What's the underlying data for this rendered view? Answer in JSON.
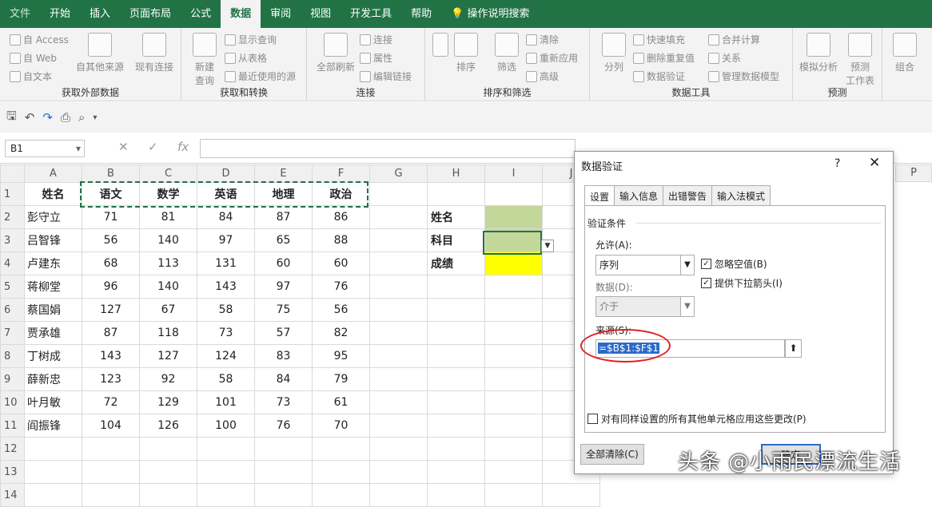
{
  "tabs": [
    "文件",
    "开始",
    "插入",
    "页面布局",
    "公式",
    "数据",
    "审阅",
    "视图",
    "开发工具",
    "帮助"
  ],
  "tell_me": "操作说明搜索",
  "ribbon": {
    "get_external": {
      "label": "获取外部数据",
      "access": "自 Access",
      "web": "自 Web",
      "text": "自文本",
      "other": "自其他来源",
      "existing": "现有连接"
    },
    "transform": {
      "label": "获取和转换",
      "new_query": "新建\n查询",
      "show_queries": "显示查询",
      "from_table": "从表格",
      "recent": "最近使用的源"
    },
    "connections": {
      "label": "连接",
      "refresh_all": "全部刷新",
      "connections": "连接",
      "properties": "属性",
      "edit_links": "编辑链接"
    },
    "sort_filter": {
      "label": "排序和筛选",
      "sort": "排序",
      "filter": "筛选",
      "clear": "清除",
      "reapply": "重新应用",
      "advanced": "高级"
    },
    "data_tools": {
      "label": "数据工具",
      "split": "分列",
      "flash_fill": "快速填充",
      "remove_dup": "删除重复值",
      "validation": "数据验证",
      "consolidate": "合并计算",
      "relations": "关系",
      "manage_model": "管理数据模型"
    },
    "forecast": {
      "label": "预测",
      "what_if": "模拟分析",
      "forecast_sheet": "预测\n工作表"
    },
    "outline": {
      "group": "组合"
    }
  },
  "namebox": "B1",
  "columns": [
    "A",
    "B",
    "C",
    "D",
    "E",
    "F",
    "G",
    "H",
    "I",
    "J"
  ],
  "headers": [
    "姓名",
    "语文",
    "数学",
    "英语",
    "地理",
    "政治"
  ],
  "rows": [
    [
      "彭守立",
      "71",
      "81",
      "84",
      "87",
      "86"
    ],
    [
      "吕智锋",
      "56",
      "140",
      "97",
      "65",
      "88"
    ],
    [
      "卢建东",
      "68",
      "113",
      "131",
      "60",
      "60"
    ],
    [
      "蒋柳堂",
      "96",
      "140",
      "143",
      "97",
      "76"
    ],
    [
      "蔡国娟",
      "127",
      "67",
      "58",
      "75",
      "56"
    ],
    [
      "贾承雄",
      "87",
      "118",
      "73",
      "57",
      "82"
    ],
    [
      "丁树成",
      "143",
      "127",
      "124",
      "83",
      "95"
    ],
    [
      "薛新忠",
      "123",
      "92",
      "58",
      "84",
      "79"
    ],
    [
      "叶月敏",
      "72",
      "129",
      "101",
      "73",
      "61"
    ],
    [
      "阎振锋",
      "104",
      "126",
      "100",
      "76",
      "70"
    ]
  ],
  "side_labels": [
    "姓名",
    "科目",
    "成绩"
  ],
  "row_numbers": [
    "1",
    "2",
    "3",
    "4",
    "5",
    "6",
    "7",
    "8",
    "9",
    "10",
    "11",
    "12",
    "13",
    "14"
  ],
  "dialog": {
    "title": "数据验证",
    "help": "?",
    "close": "✕",
    "tabs": [
      "设置",
      "输入信息",
      "出错警告",
      "输入法模式"
    ],
    "section": "验证条件",
    "allow_label": "允许(A):",
    "allow_value": "序列",
    "data_label": "数据(D):",
    "data_value": "介于",
    "ignore_blank": "忽略空值(B)",
    "dropdown": "提供下拉箭头(I)",
    "source_label": "来源(S):",
    "source_value": "=$B$1:$F$1",
    "apply_all": "对有同样设置的所有其他单元格应用这些更改(P)",
    "clear_all": "全部清除(C)",
    "ok": "确定"
  },
  "column_p": "P",
  "watermark": "头条 @小雨民漂流生活"
}
